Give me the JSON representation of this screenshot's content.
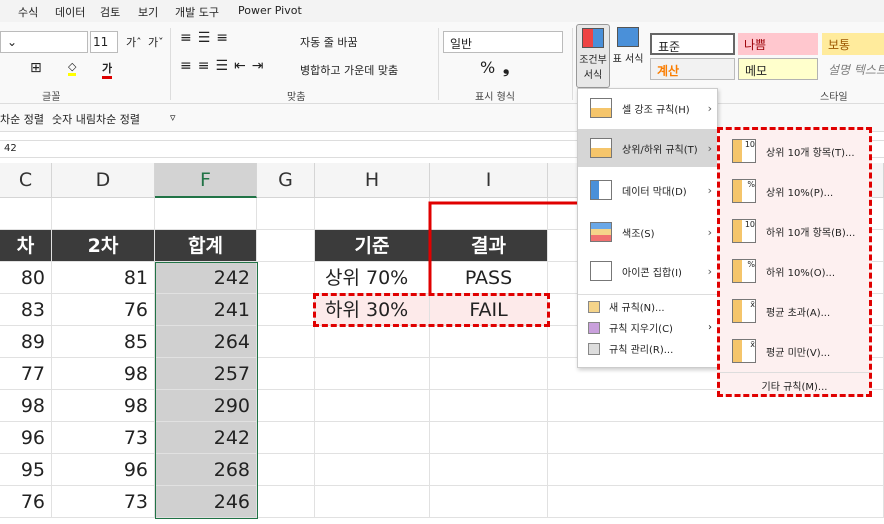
{
  "tabs": [
    "수식",
    "데이터",
    "검토",
    "보기",
    "개발 도구",
    "Power Pivot"
  ],
  "ribbon": {
    "font_size": "11",
    "grow": "가ˆ",
    "shrink": "가ˇ",
    "wrap_text": "자동 줄 바꿈",
    "merge_center": "병합하고 가운데 맞춤",
    "number_format": "일반",
    "percent": "%",
    "comma": "❟",
    "group_font": "글꼴",
    "group_align": "맞춤",
    "group_number": "표시 형식",
    "group_styles": "스타일",
    "cond_format": "조건부 서식",
    "table_format": "표 서식",
    "styles": [
      {
        "label": "표준",
        "bg": "#ffffff"
      },
      {
        "label": "나쁨",
        "bg": "#ffc7ce"
      },
      {
        "label": "보통",
        "bg": "#ffeb9c"
      },
      {
        "label": "계산",
        "bg": "#f2f2f2"
      },
      {
        "label": "메모",
        "bg": "#ffffcc"
      },
      {
        "label": "설명 텍스트",
        "bg": "#ffffff"
      }
    ]
  },
  "quickbar": {
    "asc": "차순 정렬",
    "desc": "숫자 내림차순 정렬"
  },
  "formula_value": "42",
  "columns": [
    "C",
    "D",
    "F",
    "G",
    "H",
    "I"
  ],
  "table": {
    "headers": [
      "차",
      "2차",
      "합계"
    ],
    "rows": [
      [
        80,
        81,
        242
      ],
      [
        83,
        76,
        241
      ],
      [
        89,
        85,
        264
      ],
      [
        77,
        98,
        257
      ],
      [
        98,
        98,
        290
      ],
      [
        96,
        73,
        242
      ],
      [
        95,
        96,
        268
      ],
      [
        76,
        73,
        246
      ]
    ]
  },
  "criteria": {
    "headers": [
      "기준",
      "결과"
    ],
    "rows": [
      [
        "상위 70%",
        "PASS"
      ],
      [
        "하위 30%",
        "FAIL"
      ]
    ]
  },
  "menu": {
    "items": [
      "셀 강조 규칙(H)",
      "상위/하위 규칙(T)",
      "데이터 막대(D)",
      "색조(S)",
      "아이콘 집합(I)"
    ],
    "small": [
      "새 규칙(N)...",
      "규칙 지우기(C)",
      "규칙 관리(R)..."
    ]
  },
  "submenu": {
    "items": [
      "상위 10개 항목(T)...",
      "상위 10%(P)...",
      "하위 10개 항목(B)...",
      "하위 10%(O)...",
      "평균 초과(A)...",
      "평균 미만(V)..."
    ],
    "icon_marks": [
      "10",
      "%",
      "10",
      "%",
      "x̄",
      "x̄"
    ],
    "more": "기타 규칙(M)..."
  },
  "accent": "#e00000"
}
